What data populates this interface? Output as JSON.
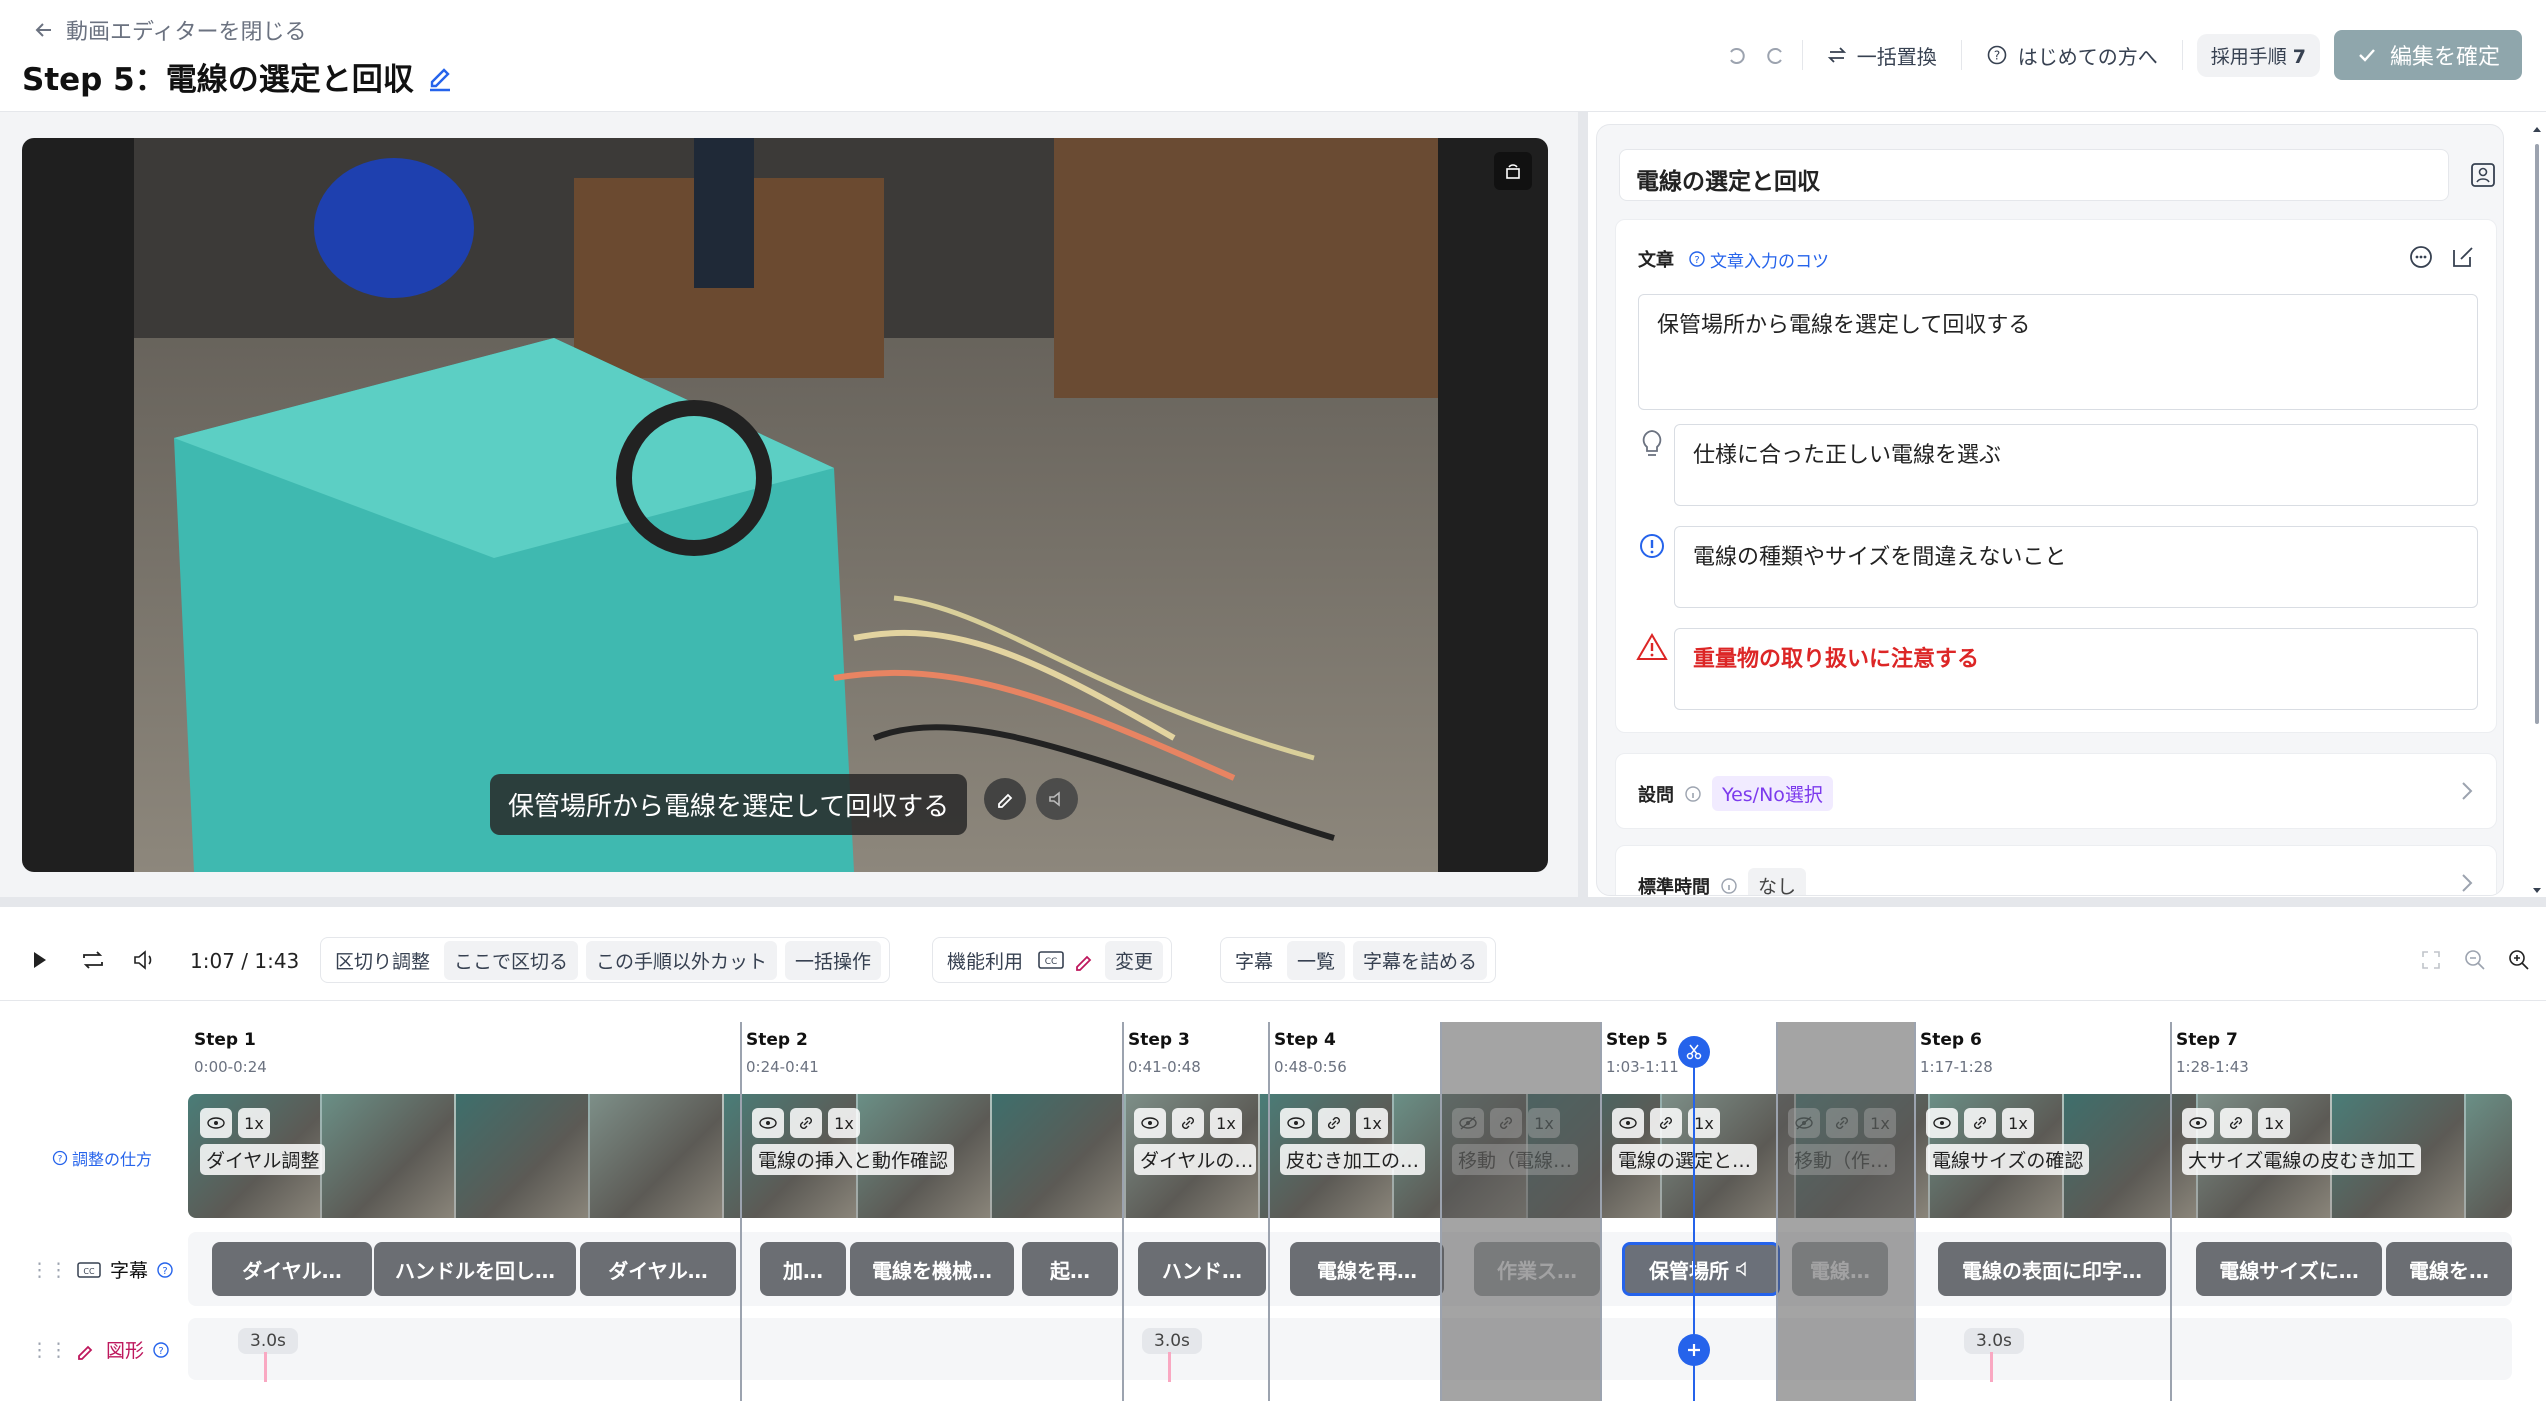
{
  "header": {
    "back_label": "動画エディターを閉じる",
    "title": "Step 5：電線の選定と回収",
    "replace_all": "一括置換",
    "first_time": "はじめての方へ",
    "adopt_label": "採用手順",
    "adopt_count": "7",
    "confirm": "編集を確定"
  },
  "video": {
    "subtitle": "保管場所から電線を選定して回収する"
  },
  "panel": {
    "step_name": "電線の選定と回収",
    "text_label": "文章",
    "tip_link": "文章入力のコツ",
    "main_text": "保管場所から電線を選定して回収する",
    "hint_text": "仕様に合った正しい電線を選ぶ",
    "caution_text": "電線の種類やサイズを間違えないこと",
    "warning_text": "重量物の取り扱いに注意する",
    "question_label": "設問",
    "question_value": "Yes/No選択",
    "std_time_label": "標準時間",
    "std_time_value": "なし"
  },
  "toolbar": {
    "time": "1:07 / 1:43",
    "cut_adjust": "区切り調整",
    "cut_here": "ここで区切る",
    "cut_others": "この手順以外カット",
    "bulk": "一括操作",
    "func_label": "機能利用",
    "change": "変更",
    "subtitle_label": "字幕",
    "list": "一覧",
    "compact": "字幕を詰める"
  },
  "timeline": {
    "how_to": "調整の仕方",
    "subtitle_track": "字幕",
    "shape_track": "図形",
    "steps": [
      {
        "label": "Step 1",
        "time": "0:00-0:24",
        "clip": "ダイヤル調整"
      },
      {
        "label": "Step 2",
        "time": "0:24-0:41",
        "clip": "電線の挿入と動作確認"
      },
      {
        "label": "Step 3",
        "time": "0:41-0:48",
        "clip": "ダイヤルの…"
      },
      {
        "label": "Step 4",
        "time": "0:48-0:56",
        "clip": "皮むき加工の…"
      },
      {
        "label": "",
        "time": "",
        "clip": "移動（電線…"
      },
      {
        "label": "Step 5",
        "time": "1:03-1:11",
        "clip": "電線の選定と…"
      },
      {
        "label": "",
        "time": "",
        "clip": "移動（作…"
      },
      {
        "label": "Step 6",
        "time": "1:17-1:28",
        "clip": "電線サイズの確認"
      },
      {
        "label": "Step 7",
        "time": "1:28-1:43",
        "clip": "大サイズ電線の皮むき加工"
      }
    ],
    "speed": "1x",
    "subtitles": [
      "ダイヤル…",
      "ハンドルを回し…",
      "ダイヤル…",
      "加…",
      "電線を機械…",
      "起…",
      "ハンド…",
      "電線を再…",
      "作業ス…",
      "保管場所",
      "電線…",
      "電線の表面に印字…",
      "電線サイズに…",
      "電線を…"
    ],
    "durations": [
      "3.0s",
      "3.0s",
      "3.0s"
    ]
  }
}
